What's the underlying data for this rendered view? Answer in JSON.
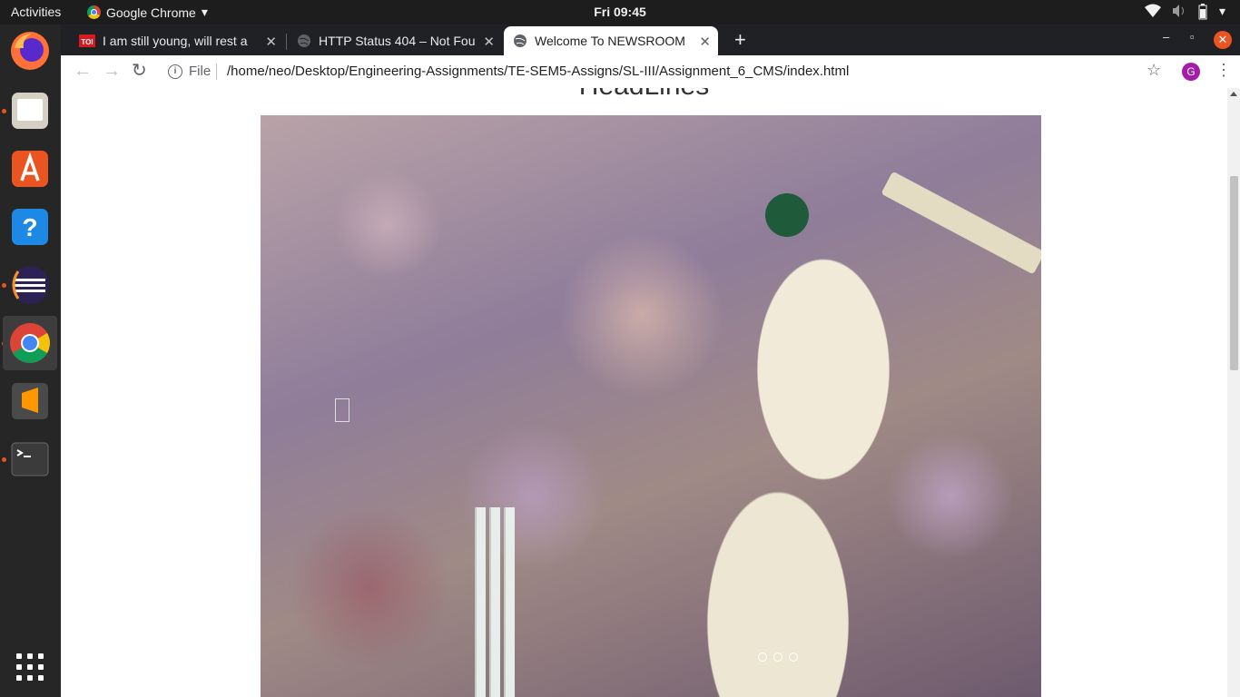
{
  "topbar": {
    "activities": "Activities",
    "app_name": "Google Chrome",
    "clock": "Fri 09:45"
  },
  "dock": {
    "apps": [
      "firefox-icon",
      "files-icon",
      "software-center-icon",
      "help-icon",
      "eclipse-icon",
      "chrome-icon",
      "sublime-text-icon",
      "terminal-icon"
    ]
  },
  "tabs": [
    {
      "label": "I am still young, will rest a",
      "favicon": "TOI"
    },
    {
      "label": "HTTP Status 404 – Not Fou",
      "favicon": "globe"
    },
    {
      "label": "Welcome To NEWSROOM",
      "favicon": "globe",
      "active": true
    }
  ],
  "toolbar": {
    "scheme": "File",
    "url": "/home/neo/Desktop/Engineering-Assignments/TE-SEM5-Assigns/SL-III/Assignment_6_CMS/index.html",
    "profile_initial": "G"
  },
  "page": {
    "heading": "HeadLines",
    "carousel": {
      "slides": 3,
      "active_slide": 1
    }
  },
  "colors": {
    "accent": "#e95420",
    "profile": "#a51cab"
  }
}
